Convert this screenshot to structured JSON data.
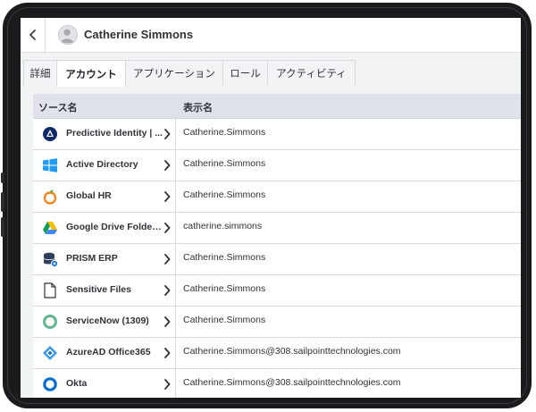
{
  "header": {
    "user_name": "Catherine Simmons"
  },
  "tabs": [
    {
      "label": "詳細"
    },
    {
      "label": "アカウント",
      "active": true
    },
    {
      "label": "アプリケーション"
    },
    {
      "label": "ロール"
    },
    {
      "label": "アクティビティ"
    }
  ],
  "table": {
    "columns": {
      "source": "ソース名",
      "display": "表示名"
    },
    "rows": [
      {
        "source": "Predictive Identity | ...",
        "display": "Catherine.Simmons",
        "icon": "sailpoint-icon"
      },
      {
        "source": "Active Directory",
        "display": "Catherine.Simmons",
        "icon": "windows-icon"
      },
      {
        "source": "Global HR",
        "display": "Catherine.Simmons",
        "icon": "orange-icon"
      },
      {
        "source": "Google Drive Folder...",
        "display": "catherine.simmons",
        "icon": "google-drive-icon"
      },
      {
        "source": "PRISM ERP",
        "display": "Catherine.Simmons",
        "icon": "database-icon"
      },
      {
        "source": "Sensitive Files",
        "display": "Catherine.Simmons",
        "icon": "file-icon"
      },
      {
        "source": "ServiceNow (1309)",
        "display": "Catherine.Simmons",
        "icon": "servicenow-icon"
      },
      {
        "source": "AzureAD Office365",
        "display": "Catherine.Simmons@308.sailpointtechnologies.com",
        "icon": "azure-icon"
      },
      {
        "source": "Okta",
        "display": "Catherine.Simmons@308.sailpointtechnologies.com",
        "icon": "okta-icon"
      }
    ]
  },
  "colors": {
    "header_bg": "#dfe2e8",
    "text": "#2f3338",
    "screen_bg": "#f2f3f5"
  }
}
